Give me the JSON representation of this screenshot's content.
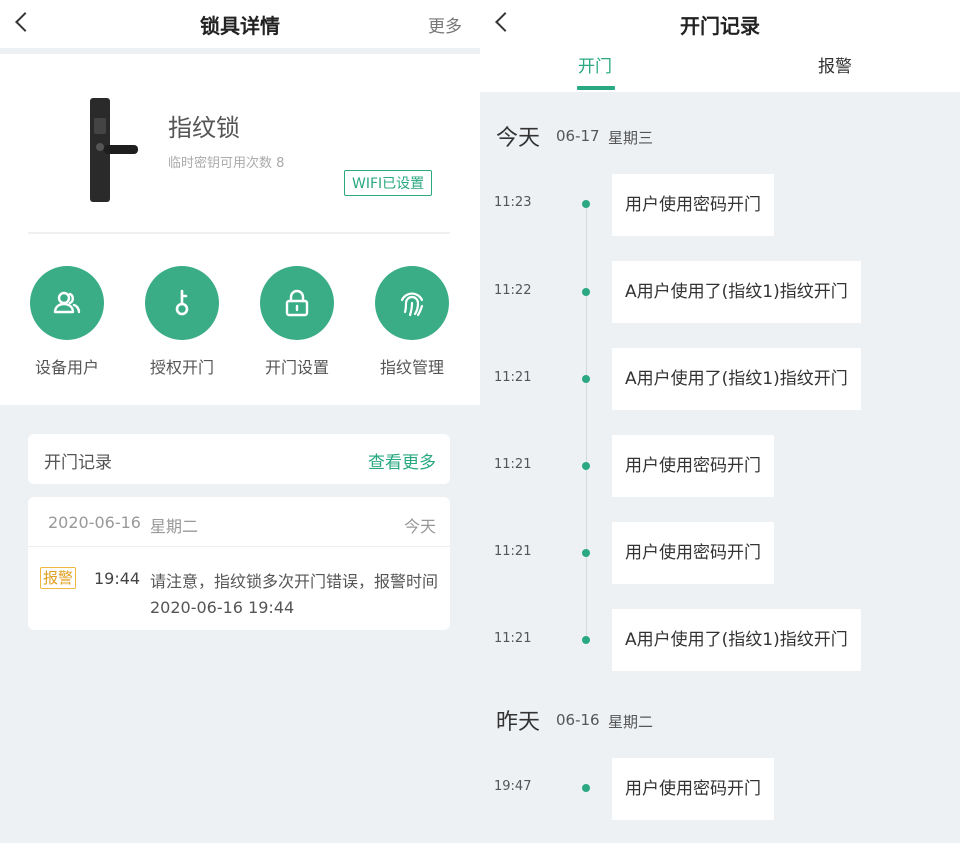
{
  "left": {
    "title": "锁具详情",
    "more": "更多",
    "device": {
      "name": "指纹锁",
      "subtitle": "临时密钥可用次数 8",
      "wifi_badge": "WIFI已设置"
    },
    "functions": [
      {
        "label": "设备用户",
        "icon": "users-icon"
      },
      {
        "label": "授权开门",
        "icon": "key-icon"
      },
      {
        "label": "开门设置",
        "icon": "unlock-icon"
      },
      {
        "label": "指纹管理",
        "icon": "fingerprint-icon"
      }
    ],
    "records_header": {
      "title": "开门记录",
      "more": "查看更多"
    },
    "record": {
      "date": "2020-06-16",
      "weekday": "星期二",
      "today": "今天",
      "tag": "报警",
      "time": "19:44",
      "message": "请注意，指纹锁多次开门错误，报警时间 2020-06-16 19:44"
    }
  },
  "right": {
    "title": "开门记录",
    "tabs": [
      {
        "label": "开门",
        "active": true
      },
      {
        "label": "报警",
        "active": false
      }
    ],
    "days": [
      {
        "label": "今天",
        "date": "06-17",
        "weekday": "星期三",
        "entries": [
          {
            "time": "11:23",
            "text": "用户使用密码开门"
          },
          {
            "time": "11:22",
            "text": "A用户使用了(指纹1)指纹开门"
          },
          {
            "time": "11:21",
            "text": "A用户使用了(指纹1)指纹开门"
          },
          {
            "time": "11:21",
            "text": "用户使用密码开门"
          },
          {
            "time": "11:21",
            "text": "用户使用密码开门"
          },
          {
            "time": "11:21",
            "text": "A用户使用了(指纹1)指纹开门"
          }
        ]
      },
      {
        "label": "昨天",
        "date": "06-16",
        "weekday": "星期二",
        "entries": [
          {
            "time": "19:47",
            "text": "用户使用密码开门"
          }
        ]
      }
    ]
  },
  "colors": {
    "accent": "#2aa881",
    "warning": "#e0a020",
    "background": "#eef1f4"
  }
}
